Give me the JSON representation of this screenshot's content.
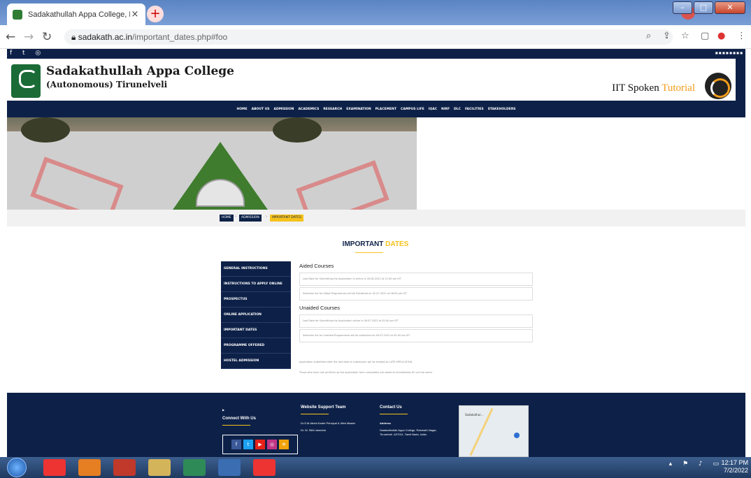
{
  "browser": {
    "tab_title": "Sadakathullah Appa College, Pal",
    "tab_close": "×",
    "new_tab": "+",
    "url_host": "sadakath.ac.in",
    "url_path": "/important_dates.php#foo"
  },
  "site": {
    "college_line1": "Sadakathullah Appa College",
    "college_line2": "(Autonomous) Tirunelveli",
    "iit_part1": "IIT Spoken",
    "iit_part2": "Tutorial"
  },
  "nav": [
    "HOME",
    "ABOUT US",
    "ADMISSION",
    "ACADEMICS",
    "RESEARCH",
    "EXAMINATION",
    "PLACEMENT",
    "CAMPUS LIFE",
    "IQAC",
    "NIRF",
    "DLC",
    "FACILITIES",
    "STAKEHOLDERS"
  ],
  "breadcrumb": {
    "home": "HOME",
    "admission": "ADMISSION",
    "current": "IMPORTANT DATES",
    "sep": "›"
  },
  "heading": {
    "part1": "IMPORTANT",
    "part2": "DATES"
  },
  "sidemenu": [
    "GENERAL INSTRUCTIONS",
    "INSTRUCTIONS TO APPLY ONLINE",
    "PROSPECTUS",
    "ONLINE APPLICATION",
    "IMPORTANT DATES",
    "PROGRAMME OFFERED",
    "HOSTEL ADMISSION"
  ],
  "aided": {
    "title": "Aided Courses",
    "rows": [
      "Last Date for Submitting the Application in online is 30.06.2022 at 11:00 pm IST",
      "Selection list for Aided Programmes will be Published on 02.07.2022 at 08:00 pm IST"
    ]
  },
  "unaided": {
    "title": "Unaided Courses",
    "rows": [
      "Last Date for Submitting the Application online is 06.07.2022 at 05:00 pm IST",
      "Selection list for Unaided Programmes will be published on 08.07.2022 at 05:00 pm IST"
    ]
  },
  "notes": [
    "Application submitted after the last date of submission will be treated as LATE APPLICATION.",
    "Those who have not yet filled up the application form completely are asked to immediately fill out the same."
  ],
  "footer": {
    "connect_title": "Connect With Us",
    "support_title": "Website Support Team",
    "support_p1": "Dr.S.M.Abdul Kader Principal & Web Master",
    "support_p2": "Dr. M. Sithi Jameela",
    "contact_title": "Contact Us",
    "contact_p1": "Address",
    "contact_p2": "Sadakathullah Appa College, Rahmath Nagar, Tirunelveli -627011, Tamil Nadu, India.",
    "map_label": "Sadakathul..."
  },
  "taskbar": {
    "time": "12:17 PM",
    "date": "7/2/2022"
  },
  "colors": {
    "navy": "#0d2148",
    "accent": "#f6c21c"
  }
}
